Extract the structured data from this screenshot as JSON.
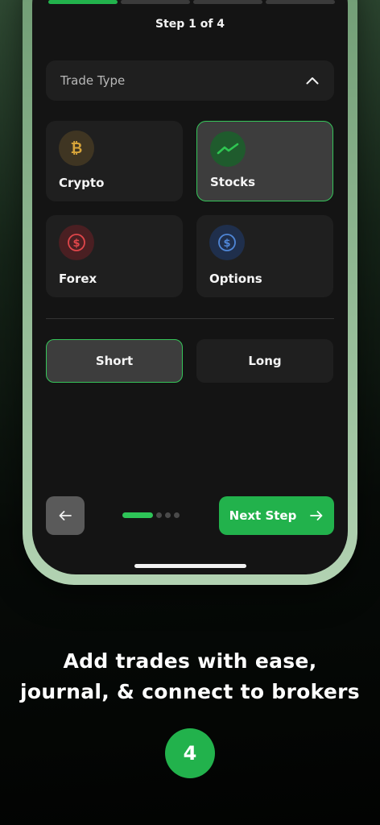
{
  "progress": {
    "total_steps": 4,
    "current_step": 1
  },
  "step_label": "Step 1 of 4",
  "trade_type": {
    "label": "Trade Type",
    "expanded": true,
    "options": [
      {
        "label": "Crypto",
        "icon": "bitcoin-icon",
        "color": "#d2a23c",
        "selected": false
      },
      {
        "label": "Stocks",
        "icon": "trend-up-icon",
        "color": "#2fbf4f",
        "selected": true
      },
      {
        "label": "Forex",
        "icon": "dollar-icon",
        "color": "#e0464a",
        "selected": false
      },
      {
        "label": "Options",
        "icon": "dollar-icon",
        "color": "#4f86d6",
        "selected": false
      }
    ]
  },
  "direction": {
    "options": [
      "Short",
      "Long"
    ],
    "selected": "Short"
  },
  "nav": {
    "back_icon": "arrow-left-icon",
    "next_label": "Next Step",
    "next_icon": "arrow-right-icon",
    "page_dots": {
      "count": 4,
      "active": 0
    }
  },
  "caption": {
    "line1": "Add trades with ease,",
    "line2": "journal, & connect to brokers"
  },
  "badge": "4",
  "colors": {
    "accent": "#22b24c",
    "background": "#141414",
    "card": "#1f1f1f"
  }
}
